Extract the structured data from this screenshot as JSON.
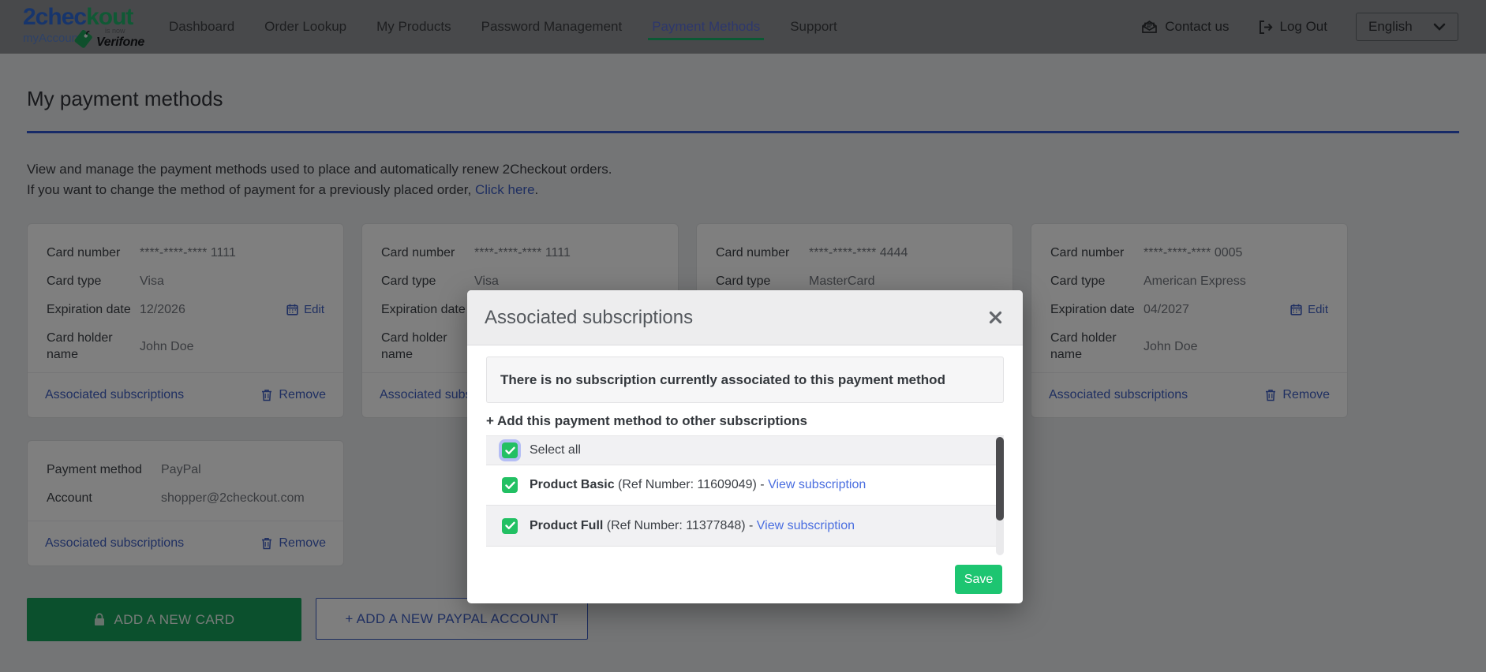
{
  "colors": {
    "brand_blue": "#2f6bd9",
    "brand_green": "#21b26b",
    "nav_active_blue": "#5b6ed9",
    "nav_underline_green": "#18b268",
    "link_blue": "#3f5fc2",
    "modal_link_blue": "#4a6ee0",
    "divider_blue": "#2f55cf",
    "button_green": "#16a15b",
    "save_green": "#1dc571",
    "checkbox_green": "#22c063"
  },
  "header": {
    "logo": {
      "brand_part_blue": "2chec",
      "brand_part_green": "kout",
      "sub_brand": "myAccount",
      "tag_line_small": "is now",
      "tag_line_brand": "Verifone"
    },
    "nav": [
      {
        "label": "Dashboard",
        "active": false
      },
      {
        "label": "Order Lookup",
        "active": false
      },
      {
        "label": "My Products",
        "active": false
      },
      {
        "label": "Password Management",
        "active": false
      },
      {
        "label": "Payment Methods",
        "active": true
      },
      {
        "label": "Support",
        "active": false
      }
    ],
    "contact_label": "Contact us",
    "logout_label": "Log Out",
    "language_selected": "English"
  },
  "page": {
    "title": "My payment methods",
    "intro_line1": "View and manage the payment methods used to place and automatically renew 2Checkout orders.",
    "intro_line2_prefix": "If you want to change the method of payment for a previously placed order, ",
    "intro_link_label": "Click here",
    "intro_suffix": "."
  },
  "labels": {
    "card_number": "Card number",
    "card_type": "Card type",
    "expiration_date": "Expiration date",
    "card_holder_name": "Card holder name",
    "payment_method": "Payment method",
    "account": "Account",
    "edit": "Edit",
    "remove": "Remove",
    "associated_subscriptions": "Associated subscriptions"
  },
  "cards": [
    {
      "number": "****-****-**** 1111",
      "type": "Visa",
      "expiration": "12/2026",
      "holder": "John Doe"
    },
    {
      "number": "****-****-**** 1111",
      "type": "Visa",
      "expiration": "",
      "holder": ""
    },
    {
      "number": "****-****-**** 4444",
      "type": "MasterCard",
      "expiration": "",
      "holder": ""
    },
    {
      "number": "****-****-**** 0005",
      "type": "American Express",
      "expiration": "04/2027",
      "holder": "John Doe"
    }
  ],
  "paypal_card": {
    "method_value": "PayPal",
    "account_value": "shopper@2checkout.com"
  },
  "buttons": {
    "add_card": "ADD A NEW CARD",
    "add_paypal": "+  ADD A NEW PAYPAL ACCOUNT"
  },
  "modal": {
    "title": "Associated subscriptions",
    "empty_message": "There is no subscription currently associated to this payment method",
    "add_heading": "+ Add this payment method to other subscriptions",
    "select_all_label": "Select all",
    "subscriptions": [
      {
        "name": "Product Basic",
        "ref_text": " (Ref Number: 11609049) - ",
        "link_label": "View subscription"
      },
      {
        "name": "Product Full",
        "ref_text": " (Ref Number: 11377848) - ",
        "link_label": "View subscription"
      }
    ],
    "save_label": "Save"
  }
}
